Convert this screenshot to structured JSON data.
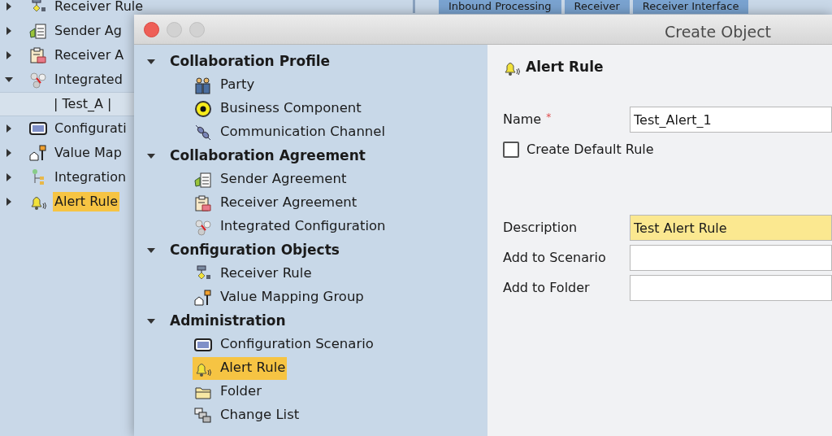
{
  "background_tree": {
    "items": [
      {
        "label": "Receiver Rule",
        "kind": "receiver-rule",
        "expanded": false,
        "selected": false
      },
      {
        "label": "Sender Ag",
        "kind": "sender-agreement",
        "expanded": false,
        "selected": false
      },
      {
        "label": "Receiver A",
        "kind": "receiver-agreement",
        "expanded": false,
        "selected": false
      },
      {
        "label": "Integrated",
        "kind": "integrated-configuration",
        "expanded": true,
        "selected": false,
        "children": [
          {
            "label": "| Test_A |"
          }
        ]
      },
      {
        "label": "Configurati",
        "kind": "configuration-scenario",
        "expanded": false,
        "selected": false
      },
      {
        "label": "Value Map",
        "kind": "value-mapping",
        "expanded": false,
        "selected": false
      },
      {
        "label": "Integration",
        "kind": "integration",
        "expanded": false,
        "selected": false
      },
      {
        "label": "Alert Rule",
        "kind": "alert-rule",
        "expanded": false,
        "selected": true
      }
    ]
  },
  "background_tabs": [
    {
      "label": "Inbound Processing"
    },
    {
      "label": "Receiver"
    },
    {
      "label": "Receiver Interface"
    }
  ],
  "dialog": {
    "title": "Create Object",
    "tree": [
      {
        "label": "Collaboration Profile",
        "expanded": true,
        "children": [
          {
            "label": "Party",
            "kind": "party",
            "selected": false
          },
          {
            "label": "Business Component",
            "kind": "business-component",
            "selected": false
          },
          {
            "label": "Communication Channel",
            "kind": "communication-channel",
            "selected": false
          }
        ]
      },
      {
        "label": "Collaboration Agreement",
        "expanded": true,
        "children": [
          {
            "label": "Sender Agreement",
            "kind": "sender-agreement",
            "selected": false
          },
          {
            "label": "Receiver Agreement",
            "kind": "receiver-agreement",
            "selected": false
          },
          {
            "label": "Integrated Configuration",
            "kind": "integrated-configuration",
            "selected": false
          }
        ]
      },
      {
        "label": "Configuration Objects",
        "expanded": true,
        "children": [
          {
            "label": "Receiver Rule",
            "kind": "receiver-rule",
            "selected": false
          },
          {
            "label": "Value Mapping Group",
            "kind": "value-mapping",
            "selected": false
          }
        ]
      },
      {
        "label": "Administration",
        "expanded": true,
        "children": [
          {
            "label": "Configuration Scenario",
            "kind": "configuration-scenario",
            "selected": false
          },
          {
            "label": "Alert Rule",
            "kind": "alert-rule",
            "selected": true
          },
          {
            "label": "Folder",
            "kind": "folder",
            "selected": false
          },
          {
            "label": "Change List",
            "kind": "change-list",
            "selected": false
          }
        ]
      }
    ],
    "form": {
      "heading": "Alert Rule",
      "name": {
        "label": "Name",
        "required_mark": "*",
        "value": "Test_Alert_1"
      },
      "default_rule": {
        "label": "Create Default Rule",
        "checked": false
      },
      "fields": [
        {
          "label": "Description",
          "value": "Test Alert Rule",
          "highlighted": true
        },
        {
          "label": "Add to Scenario",
          "highlighted": false
        },
        {
          "label": "Add to Folder",
          "highlighted": false
        }
      ]
    }
  }
}
